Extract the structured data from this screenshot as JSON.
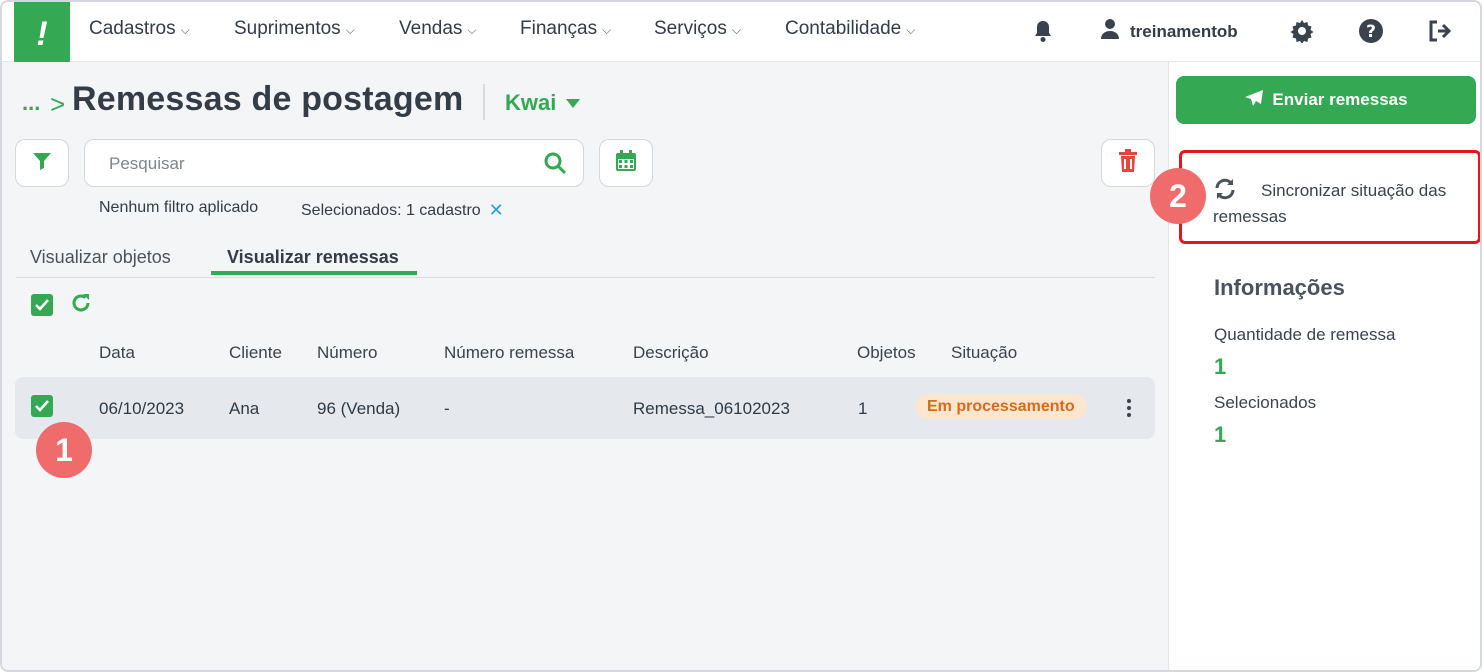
{
  "nav": {
    "logo": "!",
    "items": [
      {
        "label": "Cadastros"
      },
      {
        "label": "Suprimentos"
      },
      {
        "label": "Vendas"
      },
      {
        "label": "Finanças"
      },
      {
        "label": "Serviços"
      },
      {
        "label": "Contabilidade"
      }
    ],
    "user_name": "treinamentob",
    "icons": [
      "bell-icon",
      "user-icon",
      "gear-icon",
      "help-icon",
      "logout-icon"
    ]
  },
  "header": {
    "breadcrumb_ellipsis": "...",
    "breadcrumb_arrow": ">",
    "title": "Remessas de postagem",
    "store_label": "Kwai"
  },
  "toolbar": {
    "search_placeholder": "Pesquisar",
    "filter_status": "Nenhum filtro aplicado",
    "selected_status": "Selecionados: 1 cadastro",
    "clear_selection": "✕"
  },
  "tabs": [
    {
      "label": "Visualizar objetos",
      "active": false
    },
    {
      "label": "Visualizar remessas",
      "active": true
    }
  ],
  "table": {
    "columns": [
      "Data",
      "Cliente",
      "Número",
      "Número remessa",
      "Descrição",
      "Objetos",
      "Situação"
    ],
    "rows": [
      {
        "selected": true,
        "data": "06/10/2023",
        "cliente": "Ana",
        "numero": "96 (Venda)",
        "numero_remessa": "-",
        "descricao": "Remessa_06102023",
        "objetos": "1",
        "situacao": "Em processamento"
      }
    ]
  },
  "steps": {
    "one": "1",
    "two": "2"
  },
  "sidebar": {
    "send_label": "Enviar remessas",
    "sync_label": "Sincronizar situação das remessas",
    "info_title": "Informações",
    "qty_label": "Quantidade de remessa",
    "qty_value": "1",
    "selected_label": "Selecionados",
    "selected_value": "1"
  },
  "colors": {
    "brand_green": "#35a853",
    "highlight_red": "#e3161b",
    "step_badge": "#f06b6b",
    "status_processing_bg": "#fde6cf",
    "status_processing_text": "#d86a1b"
  }
}
